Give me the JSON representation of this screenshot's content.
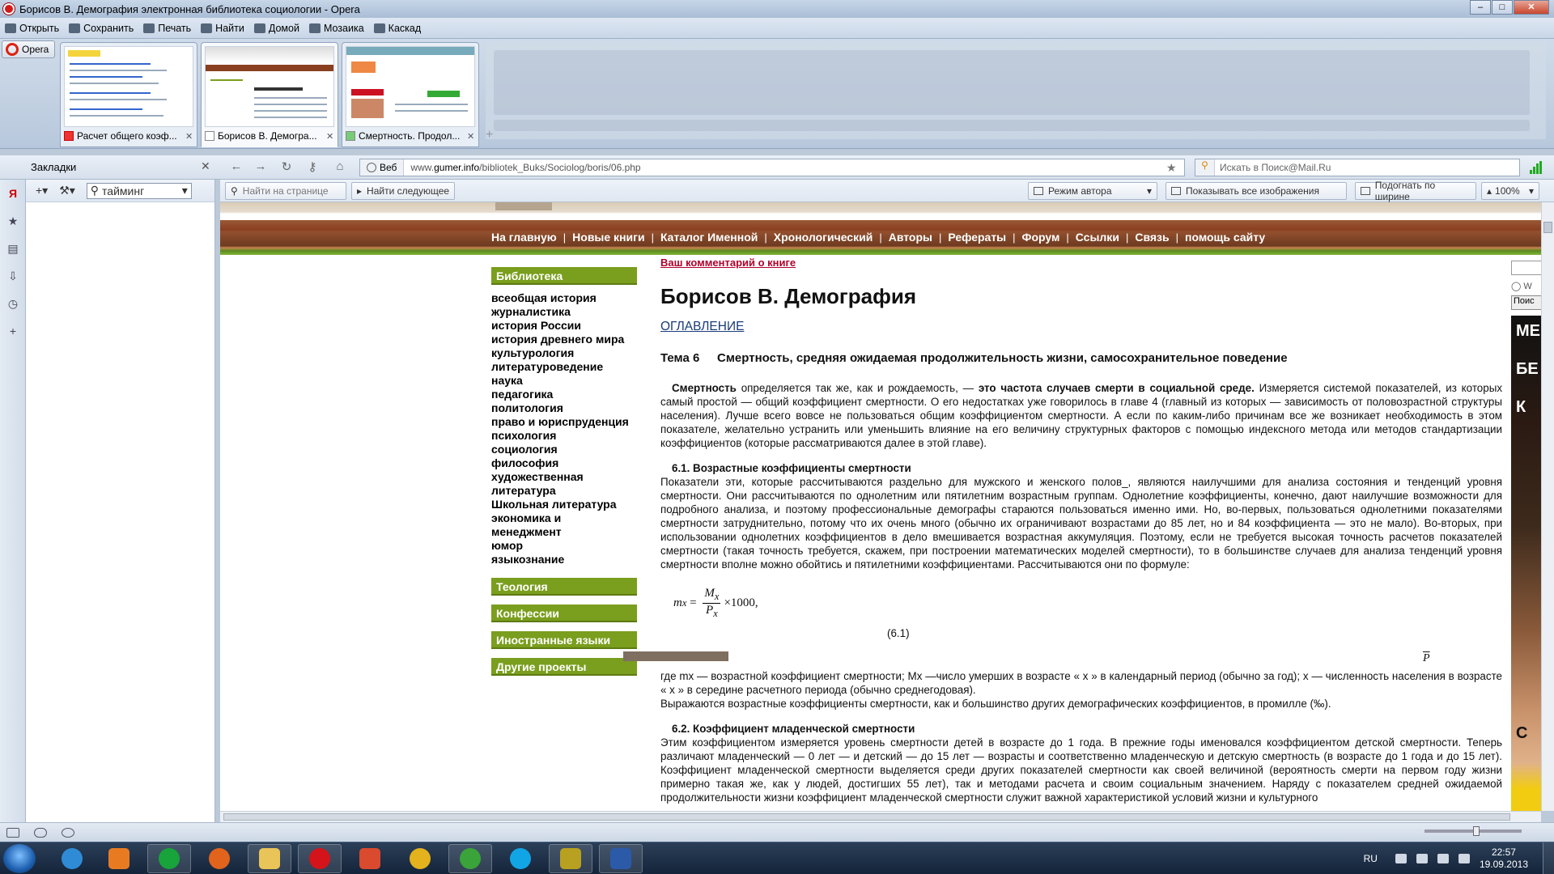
{
  "window": {
    "title": "Борисов В. Демография электронная библиотека социологии - Opera"
  },
  "menubar": {
    "items": [
      "Открыть",
      "Сохранить",
      "Печать",
      "Найти",
      "Домой",
      "Мозаика",
      "Каскад"
    ]
  },
  "opera_button": "Opera",
  "tabs": [
    {
      "label": "Расчет общего коэф...",
      "active": false
    },
    {
      "label": "Борисов В. Демогра...",
      "active": true
    },
    {
      "label": "Смертность. Продол...",
      "active": false
    }
  ],
  "sidebar_panel": {
    "title": "Закладки",
    "search_value": "тайминг"
  },
  "address": {
    "web_label": "Веб",
    "url_prefix": "www.",
    "url_domain": "gumer.info",
    "url_path": "/bibliotek_Buks/Sociolog/boris/06.php",
    "search_placeholder": "Искать в Поиск@Mail.Ru"
  },
  "findbar": {
    "find_placeholder": "Найти на странице",
    "find_next": "Найти следующее",
    "author_mode": "Режим автора",
    "show_images": "Показывать все изображения",
    "fit_width": "Подогнать по ширине",
    "zoom": "100%"
  },
  "site": {
    "nav": [
      "На главную",
      "Новые книги",
      "Каталог Именной",
      "Хронологический",
      "Авторы",
      "Рефераты",
      "Форум",
      "Ссылки",
      "Связь",
      "помощь сайту"
    ],
    "library_head": "Библиотека",
    "library_items": [
      "всеобщая история",
      "журналистика",
      "история России",
      "история древнего мира",
      "культурология",
      "литературоведение",
      "наука",
      "педагогика",
      "политология",
      "право и юриспруденция",
      "психология",
      "социология",
      "философия",
      "художественная",
      "литература",
      "Школьная литература",
      "экономика и",
      "менеджмент",
      "юмор",
      "языкознание"
    ],
    "sections": [
      "Теология",
      "Конфессии",
      "Иностранные языки",
      "Другие проекты"
    ],
    "right_search_button": "Поис",
    "right_radio_label": "W",
    "ad_letters": [
      "МЕ",
      "БЕ",
      "К",
      "С"
    ]
  },
  "article": {
    "comment_link": "Ваш комментарий о книге",
    "title": "Борисов В. Демография",
    "toc": "ОГЛАВЛЕНИЕ",
    "topic_num": "Тема 6",
    "topic_title": "Смертность, средняя ожидаемая продолжительность жизни, самосохранительное поведение",
    "p1_bold1": "Смертность",
    "p1_text1": " определяется так же, как и рождаемость, — ",
    "p1_bold2": "это частота случаев смерти в социальной среде.",
    "p1_text2": " Измеряется системой показателей, из которых самый простой — общий коэффициент смертности. О его недостатках уже говорилось в главе 4 (главный из которых — зависимость от половозрастной структуры населения). Лучше всего вовсе не пользоваться общим коэффициентом смертности. А если по каким-либо причинам все же возникает необходимость в этом показателе, желательно устранить или уменьшить влияние на его величину структурных факторов с помощью индексного метода или методов стандартизации коэффициентов (которые рассматриваются далее в этой главе).",
    "h61": "6.1. Возрастные коэффициенты смертности",
    "p2": "Показатели эти, которые рассчитываются раздельно для мужского и женского полов_, являются наилучшими для анализа состояния и тенденций уровня смертности. Они рассчитываются по однолетним или пятилетним возрастным группам. Однолетние коэффициенты, конечно, дают наилучшие возможности для подробного анализа, и поэтому профессиональные демографы стараются пользоваться именно ими. Но, во-первых, пользоваться однолетними показателями смертности затруднительно, потому что их очень много (обычно их ограничивают возрастами до 85 лет, но и 84 коэффициента — это не мало). Во-вторых, при использовании однолетних коэффициентов в дело вмешивается возрастная аккумуляция. Поэтому, если не требуется высокая точность расчетов показателей смертности (такая точность требуется, скажем, при построении математических моделей смертности), то в большинстве случаев для анализа тенденций уровня смертности вполне можно обойтись и пятилетними коэффициентами. Рассчитываются они по формуле:",
    "formula_lhs": "m",
    "formula_sub": "x",
    "formula_num": "M",
    "formula_den": "P",
    "formula_rest": "×1000,",
    "formula_label": "(6.1)",
    "p_bar": "P",
    "where_line": "где     mx —     возрастной коэффициент смертности;    Mx     —число умерших в возрасте «    x    » в календарный период (обычно за год);                     x    — численность населения в возрасте «    x    » в середине расчетного периода (обычно среднегодовая).",
    "p3": "Выражаются возрастные коэффициенты смертности, как и большинство других демографических коэффициентов, в промилле (‰).",
    "h62": "6.2. Коэффициент младенческой смертности",
    "p4": "Этим коэффициентом измеряется уровень смертности детей в возрасте до 1 года. В прежние годы именовался коэффициентом детской смертности. Теперь различают младенческий — 0 лет — и детский — до 15 лет — возрасты и соответственно младенческую и детскую смертность (в возрасте до 1 года и до 15 лет). Коэффициент младенческой смертности выделяется среди других показателей смертности как своей величиной (вероятность смерти на первом году жизни примерно такая же, как у людей, достигших 55 лет), так и методами расчета и своим социальным значением. Наряду с показателем средней ожидаемой продолжительности жизни коэффициент младенческой смертности служит важной характеристикой условий жизни и культурного"
  },
  "taskbar": {
    "lang": "RU",
    "time": "22:57",
    "date": "19.09.2013"
  }
}
